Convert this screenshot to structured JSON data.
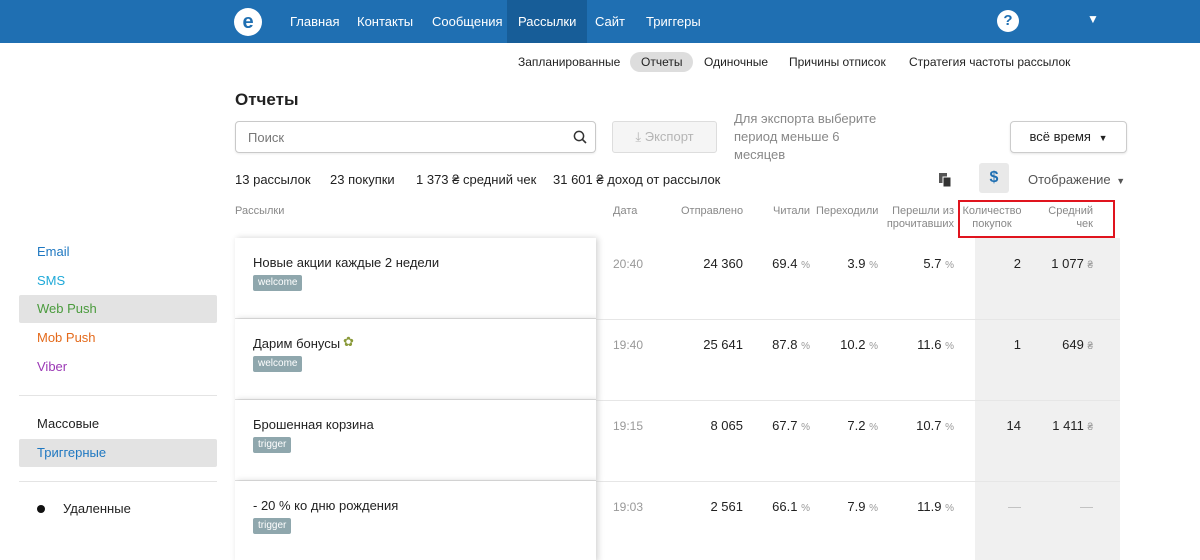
{
  "nav": {
    "items": [
      "Главная",
      "Контакты",
      "Сообщения",
      "Рассылки",
      "Сайт",
      "Триггеры"
    ],
    "help_label": "?"
  },
  "subtabs": [
    "Запланированные",
    "Отчеты",
    "Одиночные",
    "Причины отписок",
    "Стратегия частоты рассылок"
  ],
  "page_title": "Отчеты",
  "search": {
    "placeholder": "Поиск"
  },
  "export": {
    "label": "⤓ Экспорт",
    "hint": "Для экспорта выберите период меньше 6 месяцев"
  },
  "period": {
    "label": "всё время"
  },
  "stats": [
    {
      "num": "13",
      "label": "рассылок"
    },
    {
      "num": "23",
      "label": "покупки"
    },
    {
      "num": "1 373 ₴",
      "label": "средний чек"
    },
    {
      "num": "31 601 ₴",
      "label": "доход от рассылок"
    }
  ],
  "toolbar": {
    "dollar": "$",
    "display_label": "Отображение"
  },
  "columns": {
    "mailings": "Рассылки",
    "date": "Дата",
    "sent": "Отправлено",
    "read": "Читали",
    "clicked": "Переходили",
    "clicked_from_read_1": "Перешли из",
    "clicked_from_read_2": "прочитавших",
    "purchases_1": "Количество",
    "purchases_2": "покупок",
    "avg_check_1": "Средний",
    "avg_check_2": "чек"
  },
  "sidebar": {
    "channels": [
      {
        "label": "Email",
        "color": "#1f78c1"
      },
      {
        "label": "SMS",
        "color": "#1fa9d8"
      },
      {
        "label": "Web Push",
        "color": "#4a9b3d"
      },
      {
        "label": "Mob Push",
        "color": "#e46a1b"
      },
      {
        "label": "Viber",
        "color": "#9b38b5"
      }
    ],
    "types": [
      "Массовые",
      "Триггерные"
    ],
    "deleted": "Удаленные"
  },
  "rows": [
    {
      "title": "Новые акции каждые 2 недели",
      "tag": "welcome",
      "time": "20:40",
      "sent": "24 360",
      "read": "69.4",
      "clicked": "3.9",
      "ctor": "5.7",
      "purchases": "2",
      "avg": "1 077"
    },
    {
      "title": "Дарим бонусы",
      "tag": "welcome",
      "time": "19:40",
      "sent": "25 641",
      "read": "87.8",
      "clicked": "10.2",
      "ctor": "11.6",
      "purchases": "1",
      "avg": "649"
    },
    {
      "title": "Брошенная корзина",
      "tag": "trigger",
      "time": "19:15",
      "sent": "8 065",
      "read": "67.7",
      "clicked": "7.2",
      "ctor": "10.7",
      "purchases": "14",
      "avg": "1 411"
    },
    {
      "title": "- 20 % ко дню рождения",
      "tag": "trigger",
      "time": "19:03",
      "sent": "2 561",
      "read": "66.1",
      "clicked": "7.9",
      "ctor": "11.9",
      "purchases": "—",
      "avg": "—"
    }
  ],
  "units": {
    "percent": "%",
    "currency": "₴"
  }
}
